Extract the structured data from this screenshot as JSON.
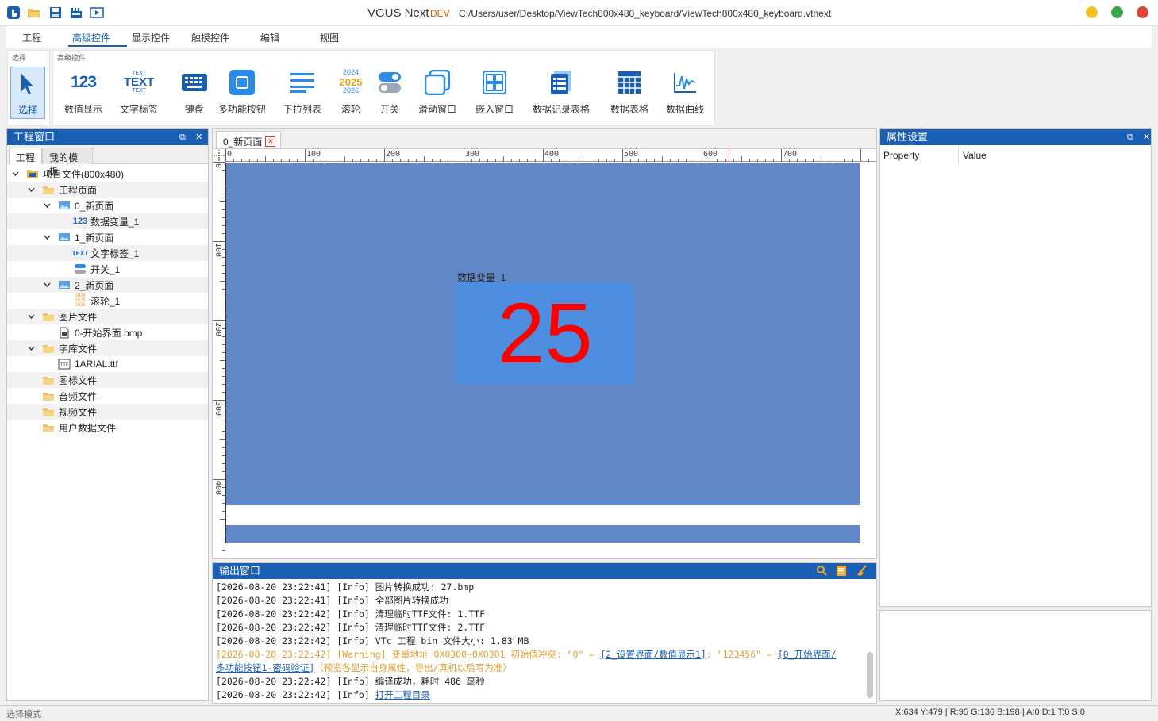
{
  "titlebar": {
    "app": "VGUS Next",
    "dev": "DEV",
    "path": "C:/Users/user/Desktop/ViewTech800x480_keyboard/ViewTech800x480_keyboard.vtnext",
    "window_buttons": {
      "minimize_color": "#f5c226",
      "maximize_color": "#3aa64a",
      "close_color": "#e0453a"
    }
  },
  "ribbon_tabs": [
    "工程",
    "高级控件",
    "显示控件",
    "触摸控件",
    "编辑",
    "视图"
  ],
  "ribbon": {
    "select_group_label": "选择",
    "select_label": "选择",
    "advanced_group_label": "高级控件",
    "tools": [
      "数值显示",
      "文字标签",
      "键盘",
      "多功能按钮",
      "下拉列表",
      "滚轮",
      "开关",
      "滑动窗口",
      "嵌入窗口",
      "数据记录表格",
      "数据表格",
      "数据曲线"
    ],
    "icon_text": {
      "number": "123",
      "text": "TEXT",
      "years": [
        "2024",
        "2025",
        "2026"
      ]
    }
  },
  "project_panel": {
    "title": "工程窗口",
    "tabs": [
      "工程",
      "我的模板"
    ],
    "tree": [
      {
        "label": "项目文件(800x480)",
        "icon": "project-icon",
        "chev": "v"
      },
      {
        "label": "工程页面",
        "icon": "folder-icon",
        "chev": "v"
      },
      {
        "label": "0_新页面",
        "icon": "page-icon",
        "chev": "v"
      },
      {
        "label": "数据变量_1",
        "icon": "number-icon",
        "chev": ""
      },
      {
        "label": "1_新页面",
        "icon": "page-icon",
        "chev": "v"
      },
      {
        "label": "文字标签_1",
        "icon": "text-icon",
        "chev": ""
      },
      {
        "label": "开关_1",
        "icon": "switch-icon",
        "chev": ""
      },
      {
        "label": "2_新页面",
        "icon": "page-icon",
        "chev": "v"
      },
      {
        "label": "滚轮_1",
        "icon": "roller-icon",
        "chev": ""
      },
      {
        "label": "图片文件",
        "icon": "folder-icon",
        "chev": "v"
      },
      {
        "label": "0-开始界面.bmp",
        "icon": "file-icon",
        "chev": ""
      },
      {
        "label": "字库文件",
        "icon": "folder-icon",
        "chev": "v"
      },
      {
        "label": "1ARIAL.ttf",
        "icon": "font-file-icon",
        "chev": ""
      },
      {
        "label": "图标文件",
        "icon": "folder-icon",
        "chev": ""
      },
      {
        "label": "音频文件",
        "icon": "folder-icon",
        "chev": ""
      },
      {
        "label": "视频文件",
        "icon": "folder-icon",
        "chev": ""
      },
      {
        "label": "用户数据文件",
        "icon": "folder-icon",
        "chev": ""
      }
    ]
  },
  "document": {
    "tab_label": "0_新页面",
    "ruler_h": [
      "0",
      "100",
      "200",
      "300",
      "400",
      "500",
      "600",
      "700"
    ],
    "ruler_v": [
      "0",
      "100",
      "200",
      "300",
      "400"
    ],
    "data_variable": {
      "label": "数据变量_1",
      "value": "25"
    },
    "screen_color": "#6088c8"
  },
  "output": {
    "title": "输出窗口",
    "lines": [
      {
        "type": "info",
        "text": "[2026-08-20 23:22:41] [Info] 图片转换成功: 27.bmp"
      },
      {
        "type": "info",
        "text": "[2026-08-20 23:22:41] [Info] 全部图片转换成功"
      },
      {
        "type": "info",
        "text": "[2026-08-20 23:22:42] [Info] 清理临时TTF文件: 1.TTF"
      },
      {
        "type": "info",
        "text": "[2026-08-20 23:22:42] [Info] 清理临时TTF文件: 2.TTF"
      },
      {
        "type": "info",
        "text": "[2026-08-20 23:22:42] [Info] VTc 工程 bin 文件大小: 1.83 MB"
      }
    ],
    "warning": {
      "prefix": "[2026-08-20 23:22:42] [Warning] 变量地址 0X0300~0X0301 初始值冲突: \"0\" ← ",
      "link1": "[2_设置界面/数值显示1]",
      "mid": ": \"123456\" ← ",
      "link2a": "[0_开始界面/",
      "link2b": "多功能按钮1-密码验证]",
      "suffix": "（预览各显示自身属性，导出/真机以后写为准）"
    },
    "tail_lines": [
      {
        "type": "info",
        "text": "[2026-08-20 23:22:42] [Info] 编译成功，耗时 486 毫秒"
      },
      {
        "type": "link",
        "prefix": "[2026-08-20 23:22:42] [Info] ",
        "link": "打开工程目录"
      }
    ]
  },
  "properties": {
    "title": "属性设置",
    "col_property": "Property",
    "col_value": "Value"
  },
  "status": {
    "left": "选择模式",
    "right": "X:634  Y:479  |  R:95 G:136 B:198  |  A:0  D:1  T:0  S:0"
  }
}
